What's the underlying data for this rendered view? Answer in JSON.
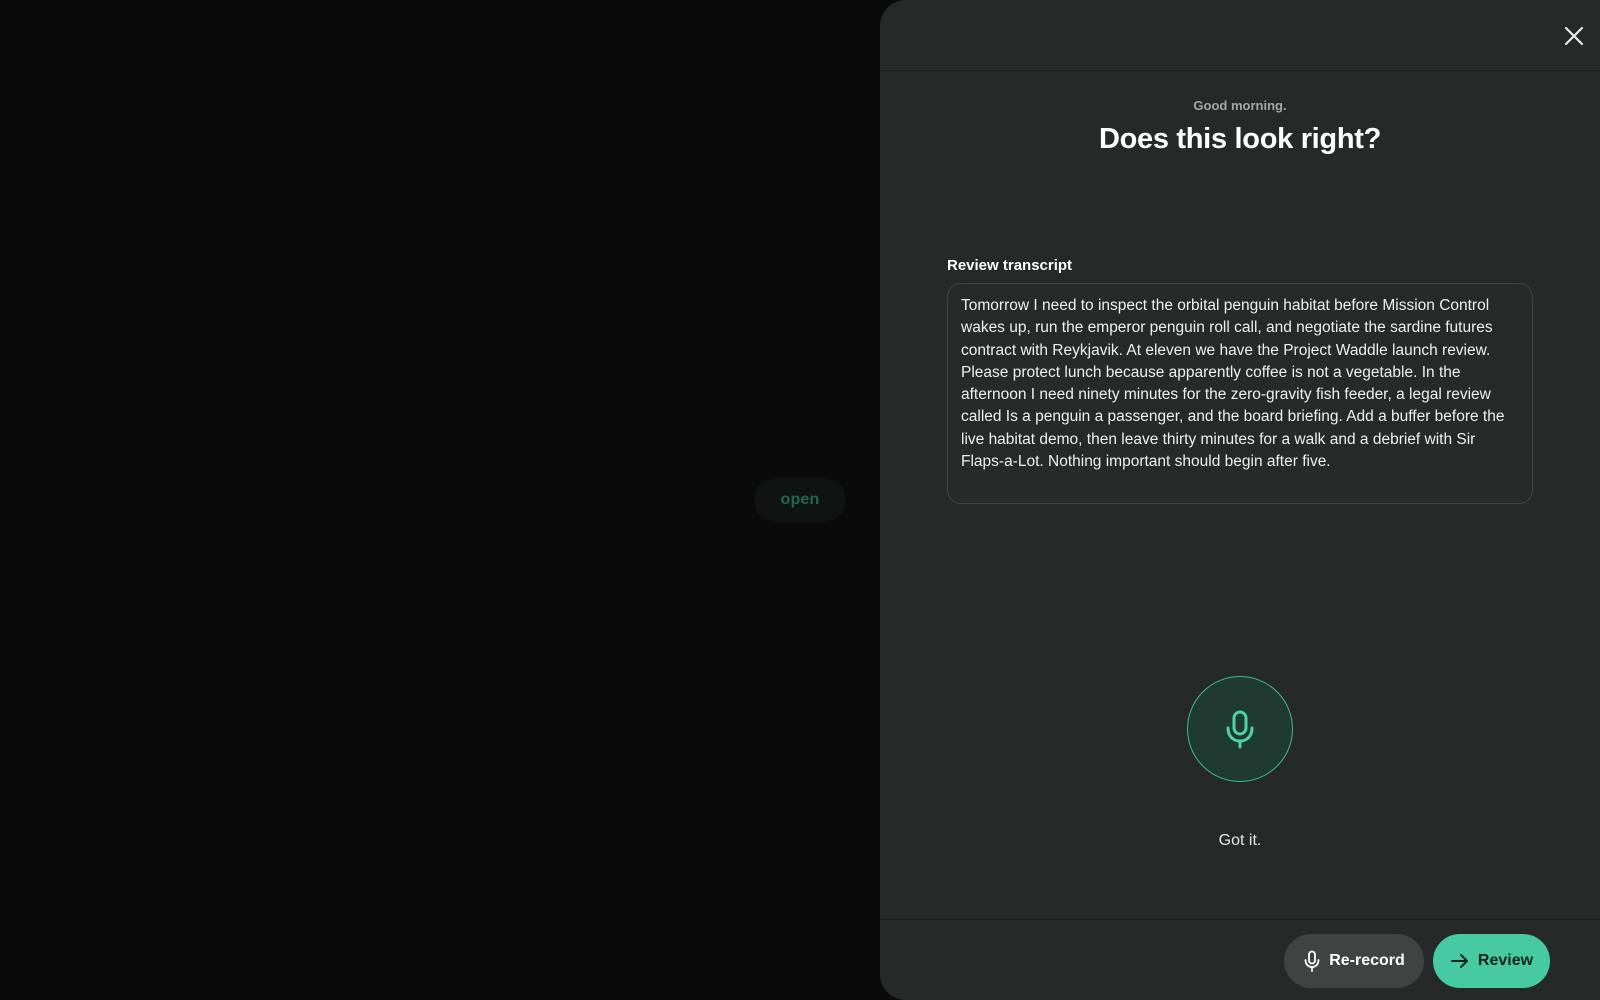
{
  "background": {
    "open_label": "open"
  },
  "panel": {
    "greeting": "Good morning.",
    "title": "Does this look right?",
    "transcript_label": "Review transcript",
    "transcript_text": "Tomorrow I need to inspect the orbital penguin habitat before Mission Control wakes up, run the emperor penguin roll call, and negotiate the sardine futures contract with Reykjavik. At eleven we have the Project Waddle launch review. Please protect lunch because apparently coffee is not a vegetable. In the afternoon I need ninety minutes for the zero-gravity fish feeder, a legal review called Is a penguin a passenger, and the board briefing. Add a buffer before the live habitat demo, then leave thirty minutes for a walk and a debrief with Sir Flaps-a-Lot. Nothing important should begin after five.",
    "status": "Got it."
  },
  "footer": {
    "rerecord_label": "Re-record",
    "review_label": "Review"
  },
  "icons": {
    "close": "close-icon",
    "mic": "microphone-icon",
    "arrow": "arrow-right-icon"
  },
  "colors": {
    "accent": "#47c9a1",
    "panel_bg": "#252a29",
    "backdrop": "#0a0a0a"
  }
}
